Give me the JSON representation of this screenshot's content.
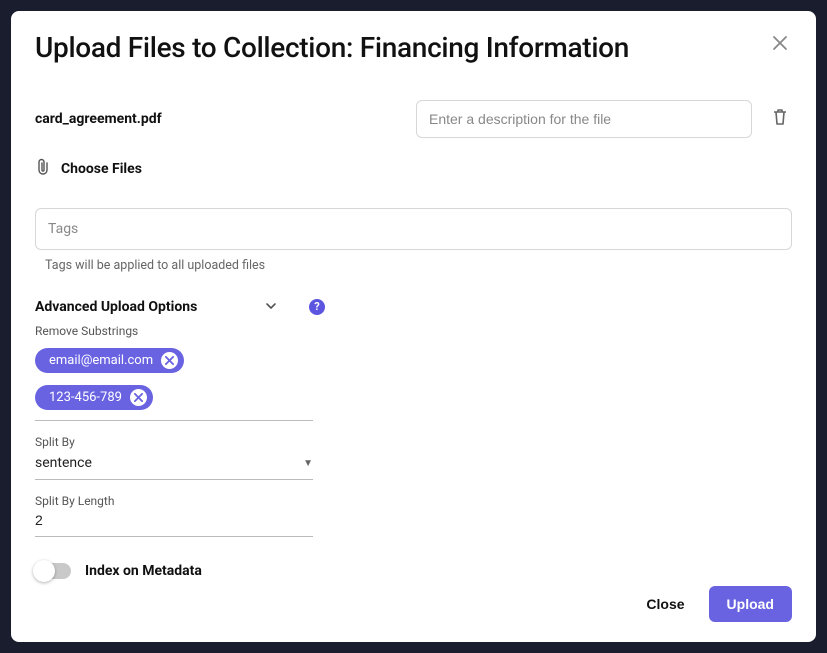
{
  "header": {
    "title": "Upload Files to Collection: Financing Information"
  },
  "file": {
    "name": "card_agreement.pdf",
    "desc_placeholder": "Enter a description for the file"
  },
  "choose_label": "Choose Files",
  "tags": {
    "placeholder": "Tags",
    "note": "Tags will be applied to all uploaded files"
  },
  "advanced": {
    "label": "Advanced Upload Options",
    "help": "?",
    "remove_substrings_label": "Remove Substrings",
    "chips": [
      "email@email.com",
      "123-456-789"
    ],
    "split_by_label": "Split By",
    "split_by_value": "sentence",
    "split_by_length_label": "Split By Length",
    "split_by_length_value": "2",
    "index_metadata_label": "Index on Metadata"
  },
  "footer": {
    "close": "Close",
    "upload": "Upload"
  }
}
